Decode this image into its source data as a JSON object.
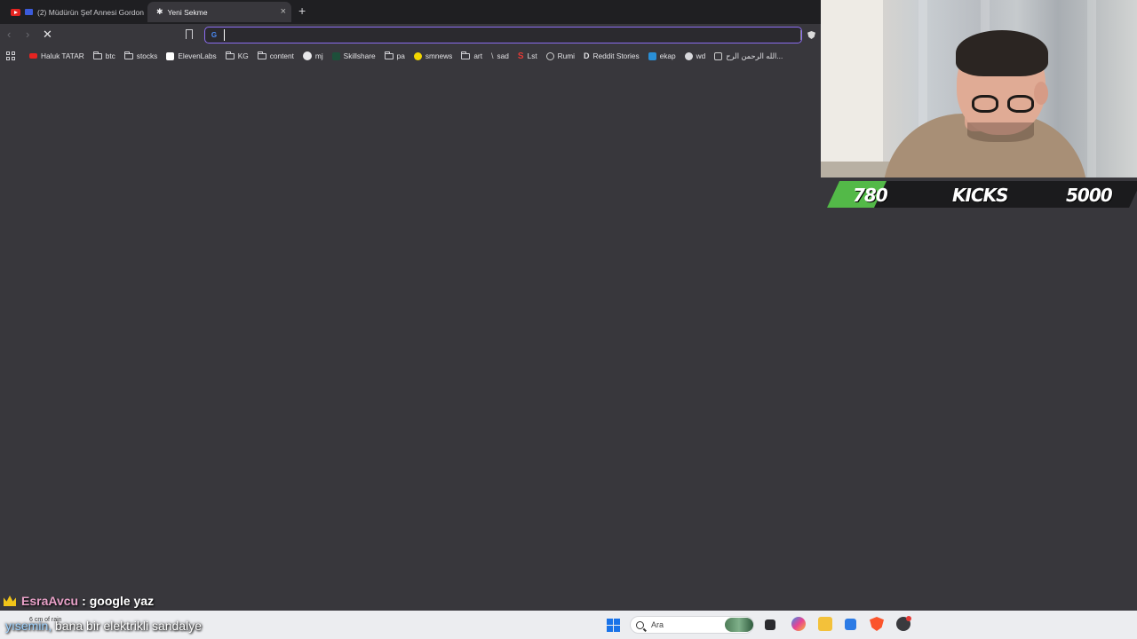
{
  "browser": {
    "tabs": [
      {
        "title": "(2) Müdürün Şef Annesi Gordon",
        "active": false
      },
      {
        "title": "Yeni Sekme",
        "active": true
      }
    ],
    "tab_close": "×",
    "new_tab": "+",
    "nav": {
      "back": "‹",
      "forward": "›",
      "stop": "✕"
    },
    "omnibox": {
      "value": "",
      "engine_icon": "G"
    },
    "bookmarks": [
      {
        "label": "Haluk TATAR",
        "icon": "youtube-icon"
      },
      {
        "label": "btc",
        "icon": "folder-icon"
      },
      {
        "label": "stocks",
        "icon": "folder-icon"
      },
      {
        "label": "ElevenLabs",
        "icon": "elevenlabs-icon"
      },
      {
        "label": "KG",
        "icon": "folder-icon"
      },
      {
        "label": "content",
        "icon": "folder-icon"
      },
      {
        "label": "mj",
        "icon": "github-icon"
      },
      {
        "label": "Skillshare",
        "icon": "skillshare-icon"
      },
      {
        "label": "pa",
        "icon": "folder-icon"
      },
      {
        "label": "smnews",
        "icon": "smnews-icon"
      },
      {
        "label": "art",
        "icon": "folder-icon"
      },
      {
        "label": "sad",
        "icon": "pen-icon"
      },
      {
        "label": "Lst",
        "icon": "s-icon"
      },
      {
        "label": "Rumi",
        "icon": "globe-icon"
      },
      {
        "label": "Reddit Stories",
        "icon": "d-icon"
      },
      {
        "label": "ekap",
        "icon": "ekap-icon"
      },
      {
        "label": "wd",
        "icon": "wd-icon"
      },
      {
        "label": "الله الرحمن الرح...",
        "icon": "book-icon"
      }
    ]
  },
  "goal": {
    "current": "780",
    "label": "KICKS",
    "target": "5000",
    "progress": 0.156,
    "fill_color": "#53b948"
  },
  "chat": {
    "user": "EsraAvcu",
    "separator": ":",
    "message": "google yaz"
  },
  "taskbar": {
    "weather_text": "6 cm of rain",
    "subtitle_highlight": "yısemin,",
    "subtitle_rest": " bana bir elektrikli sandalye",
    "search_placeholder": "Ara"
  }
}
